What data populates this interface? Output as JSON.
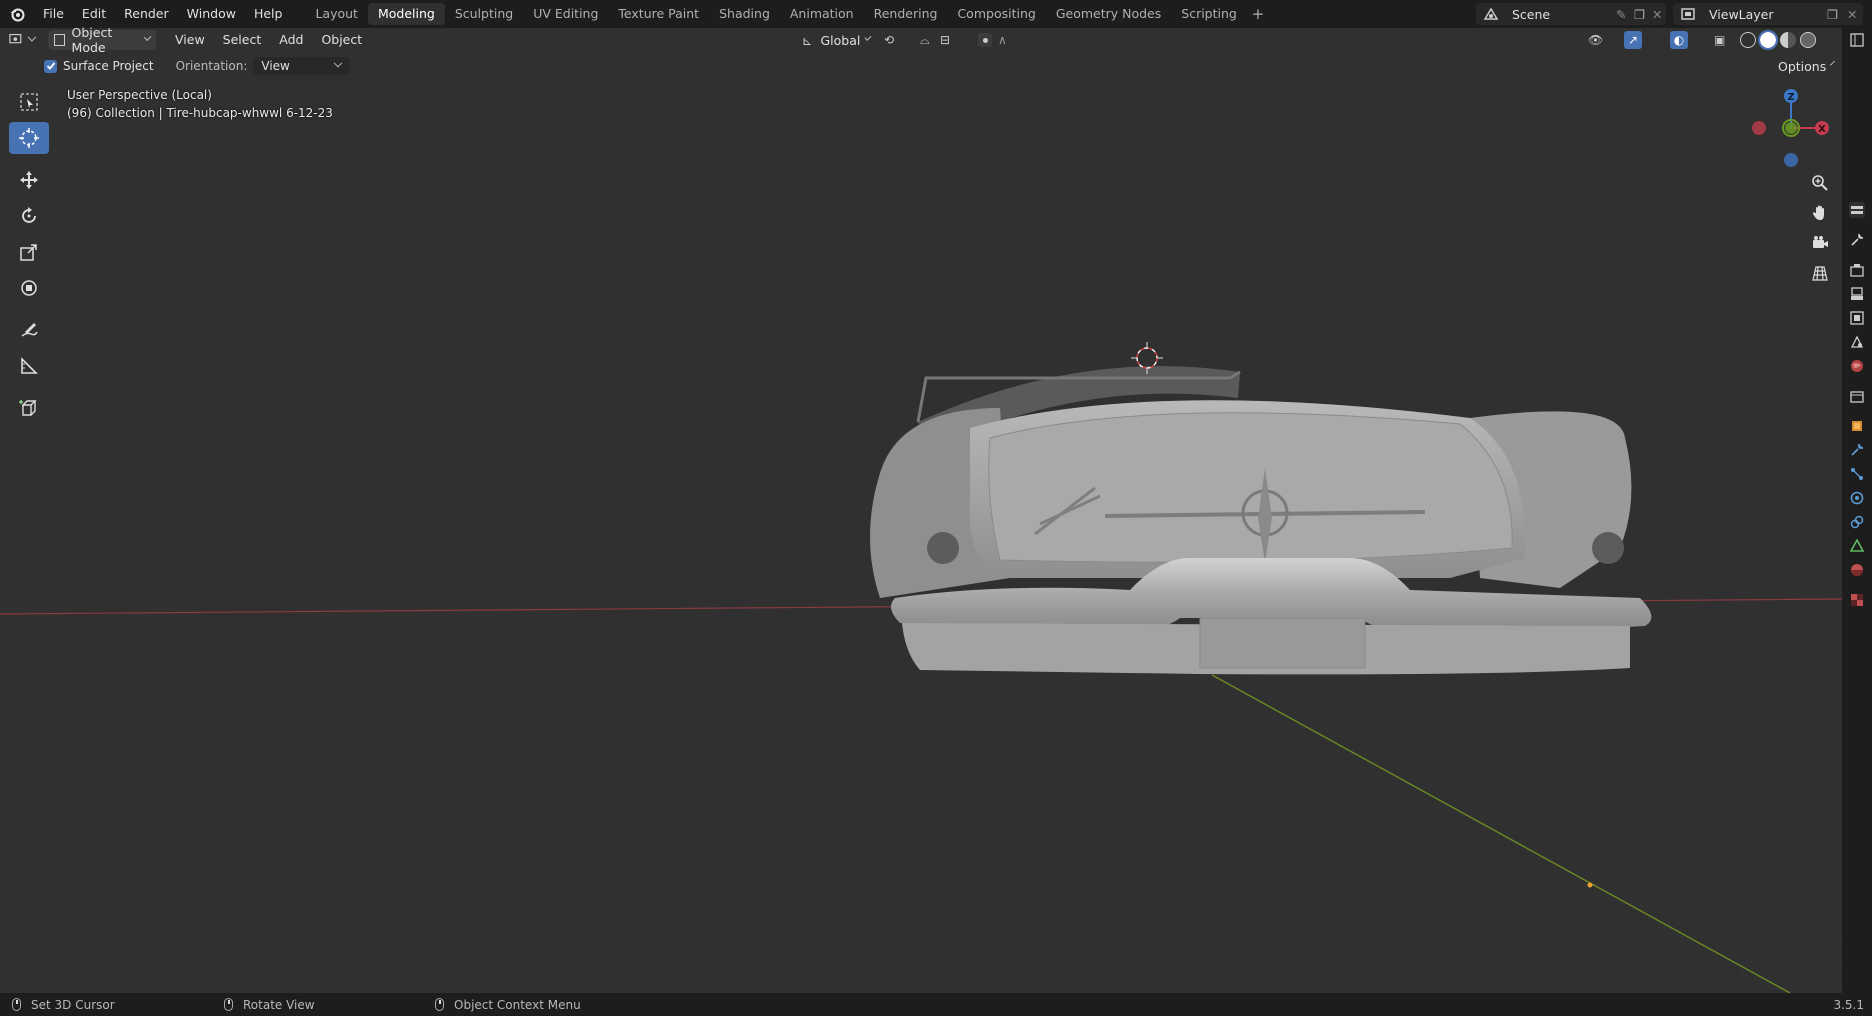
{
  "topbar": {
    "menus": [
      "File",
      "Edit",
      "Render",
      "Window",
      "Help"
    ],
    "workspaces": [
      "Layout",
      "Modeling",
      "Sculpting",
      "UV Editing",
      "Texture Paint",
      "Shading",
      "Animation",
      "Rendering",
      "Compositing",
      "Geometry Nodes",
      "Scripting"
    ],
    "active_workspace": "Modeling",
    "add_symbol": "+",
    "scene": "Scene",
    "view_layer": "ViewLayer"
  },
  "header": {
    "mode": "Object Mode",
    "menus": [
      "View",
      "Select",
      "Add",
      "Object"
    ],
    "transform_orientation": "Global",
    "options_label": "Options"
  },
  "tool_settings": {
    "surface_project_label": "Surface Project",
    "surface_project_checked": true,
    "orientation_label": "Orientation:",
    "orientation_value": "View"
  },
  "viewport": {
    "perspective_label": "User Perspective (Local)",
    "collection_label": "(96) Collection | Tire-hubcap-whwwl  6-12-23",
    "axis_labels": {
      "x": "X",
      "y": "Y",
      "z": "Z"
    },
    "colors": {
      "x_axis": "#c43d4e",
      "y_axis": "#6a9a22",
      "z_axis": "#3c78c8",
      "accent": "#4772b3"
    }
  },
  "toolbar": {
    "tools": [
      "select-box-icon",
      "cursor-icon",
      "move-icon",
      "rotate-icon",
      "scale-icon",
      "transform-icon",
      "annotate-icon",
      "measure-icon",
      "add-cube-icon"
    ],
    "active_tool": "cursor-icon"
  },
  "statusbar": {
    "items": [
      "Set 3D Cursor",
      "Rotate View",
      "Object Context Menu"
    ],
    "version": "3.5.1"
  }
}
